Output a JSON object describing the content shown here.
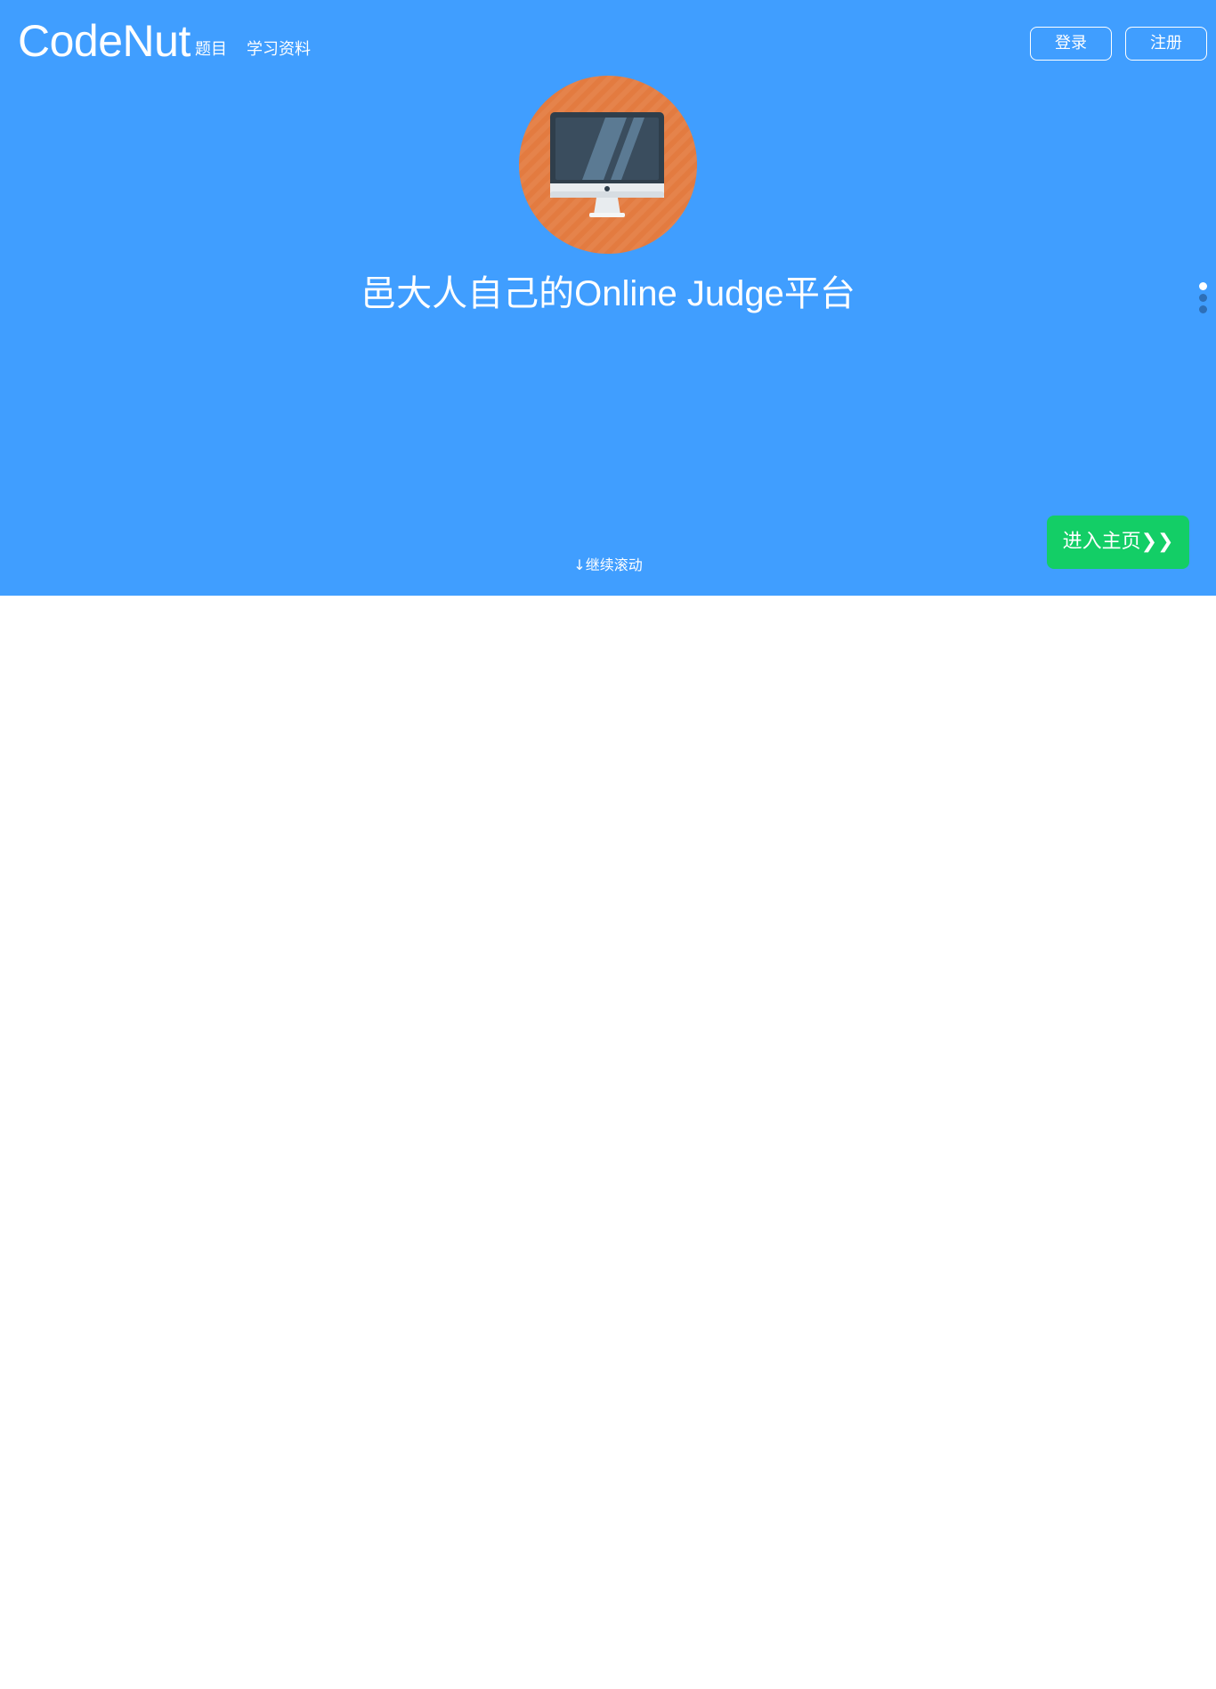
{
  "header": {
    "brand": "CodeNut",
    "nav": {
      "problems": "题目",
      "learning": "学习资料"
    },
    "auth": {
      "login": "登录",
      "register": "注册"
    }
  },
  "hero": {
    "icon": "computer-monitor-icon",
    "title": "邑大人自己的Online Judge平台",
    "scroll_hint": "↓继续滚动",
    "enter_button": "进入主页❯❯",
    "page_dots": [
      {
        "state": "active"
      },
      {
        "state": "inactive"
      },
      {
        "state": "inactive"
      }
    ]
  },
  "colors": {
    "hero_background": "#409eff",
    "enter_button": "#13ce66",
    "icon_circle": "#e37b40"
  }
}
